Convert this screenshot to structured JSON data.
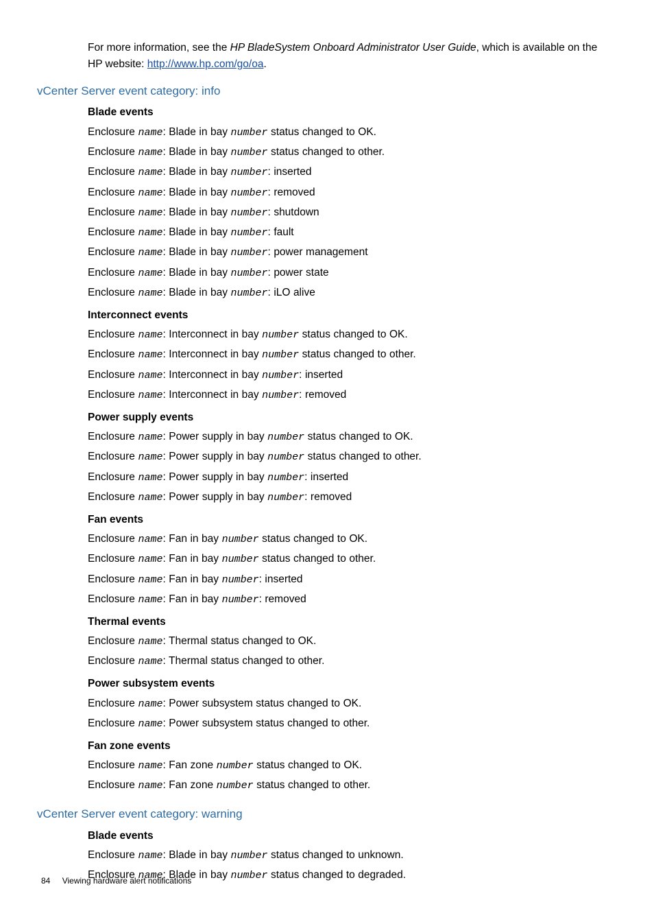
{
  "intro": {
    "pre": "For more information, see the ",
    "ital": "HP BladeSystem Onboard Administrator User Guide",
    "post1": ", which is available on the HP website: ",
    "link": "http://www.hp.com/go/oa",
    "post2": "."
  },
  "sections": [
    {
      "title": "vCenter Server event category: info",
      "groups": [
        {
          "heading": "Blade events",
          "lines": [
            [
              [
                "t",
                "Enclosure "
              ],
              [
                "v",
                "name"
              ],
              [
                "t",
                ": Blade in bay "
              ],
              [
                "v",
                "number"
              ],
              [
                "t",
                " status changed to OK."
              ]
            ],
            [
              [
                "t",
                "Enclosure "
              ],
              [
                "v",
                "name"
              ],
              [
                "t",
                ": Blade in bay "
              ],
              [
                "v",
                "number"
              ],
              [
                "t",
                " status changed to other."
              ]
            ],
            [
              [
                "t",
                "Enclosure "
              ],
              [
                "v",
                "name"
              ],
              [
                "t",
                ": Blade in bay "
              ],
              [
                "v",
                "number"
              ],
              [
                "t",
                ": inserted"
              ]
            ],
            [
              [
                "t",
                "Enclosure "
              ],
              [
                "v",
                "name"
              ],
              [
                "t",
                ": Blade in bay "
              ],
              [
                "v",
                "number"
              ],
              [
                "t",
                ": removed"
              ]
            ],
            [
              [
                "t",
                "Enclosure "
              ],
              [
                "v",
                "name"
              ],
              [
                "t",
                ": Blade in bay "
              ],
              [
                "v",
                "number"
              ],
              [
                "t",
                ": shutdown"
              ]
            ],
            [
              [
                "t",
                "Enclosure "
              ],
              [
                "v",
                "name"
              ],
              [
                "t",
                ": Blade in bay "
              ],
              [
                "v",
                "number"
              ],
              [
                "t",
                ": fault"
              ]
            ],
            [
              [
                "t",
                "Enclosure "
              ],
              [
                "v",
                "name"
              ],
              [
                "t",
                ": Blade in bay "
              ],
              [
                "v",
                "number"
              ],
              [
                "t",
                ": power management"
              ]
            ],
            [
              [
                "t",
                "Enclosure "
              ],
              [
                "v",
                "name"
              ],
              [
                "t",
                ": Blade in bay "
              ],
              [
                "v",
                "number"
              ],
              [
                "t",
                ": power state"
              ]
            ],
            [
              [
                "t",
                "Enclosure "
              ],
              [
                "v",
                "name"
              ],
              [
                "t",
                ": Blade in bay "
              ],
              [
                "v",
                "number"
              ],
              [
                "t",
                ": iLO alive"
              ]
            ]
          ]
        },
        {
          "heading": "Interconnect events",
          "lines": [
            [
              [
                "t",
                "Enclosure "
              ],
              [
                "v",
                "name"
              ],
              [
                "t",
                ": Interconnect in bay "
              ],
              [
                "v",
                "number"
              ],
              [
                "t",
                " status changed to OK."
              ]
            ],
            [
              [
                "t",
                "Enclosure "
              ],
              [
                "v",
                "name"
              ],
              [
                "t",
                ": Interconnect in bay "
              ],
              [
                "v",
                "number"
              ],
              [
                "t",
                " status changed to other."
              ]
            ],
            [
              [
                "t",
                "Enclosure "
              ],
              [
                "v",
                "name"
              ],
              [
                "t",
                ": Interconnect in bay "
              ],
              [
                "v",
                "number"
              ],
              [
                "t",
                ": inserted"
              ]
            ],
            [
              [
                "t",
                "Enclosure "
              ],
              [
                "v",
                "name"
              ],
              [
                "t",
                ": Interconnect in bay "
              ],
              [
                "v",
                "number"
              ],
              [
                "t",
                ": removed"
              ]
            ]
          ]
        },
        {
          "heading": "Power supply events",
          "lines": [
            [
              [
                "t",
                "Enclosure "
              ],
              [
                "v",
                "name"
              ],
              [
                "t",
                ": Power supply in bay "
              ],
              [
                "v",
                "number"
              ],
              [
                "t",
                " status changed to OK."
              ]
            ],
            [
              [
                "t",
                "Enclosure "
              ],
              [
                "v",
                "name"
              ],
              [
                "t",
                ": Power supply in bay "
              ],
              [
                "v",
                "number"
              ],
              [
                "t",
                " status changed to other."
              ]
            ],
            [
              [
                "t",
                "Enclosure "
              ],
              [
                "v",
                "name"
              ],
              [
                "t",
                ": Power supply in bay "
              ],
              [
                "v",
                "number"
              ],
              [
                "t",
                ": inserted"
              ]
            ],
            [
              [
                "t",
                "Enclosure "
              ],
              [
                "v",
                "name"
              ],
              [
                "t",
                ": Power supply in bay "
              ],
              [
                "v",
                "number"
              ],
              [
                "t",
                ": removed"
              ]
            ]
          ]
        },
        {
          "heading": "Fan events",
          "lines": [
            [
              [
                "t",
                "Enclosure "
              ],
              [
                "v",
                "name"
              ],
              [
                "t",
                ": Fan in bay "
              ],
              [
                "v",
                "number"
              ],
              [
                "t",
                " status changed to OK."
              ]
            ],
            [
              [
                "t",
                "Enclosure "
              ],
              [
                "v",
                "name"
              ],
              [
                "t",
                ": Fan in bay "
              ],
              [
                "v",
                "number"
              ],
              [
                "t",
                " status changed to other."
              ]
            ],
            [
              [
                "t",
                "Enclosure "
              ],
              [
                "v",
                "name"
              ],
              [
                "t",
                ": Fan in bay "
              ],
              [
                "v",
                "number"
              ],
              [
                "t",
                ": inserted"
              ]
            ],
            [
              [
                "t",
                "Enclosure "
              ],
              [
                "v",
                "name"
              ],
              [
                "t",
                ": Fan in bay "
              ],
              [
                "v",
                "number"
              ],
              [
                "t",
                ": removed"
              ]
            ]
          ]
        },
        {
          "heading": "Thermal events",
          "lines": [
            [
              [
                "t",
                "Enclosure "
              ],
              [
                "v",
                "name"
              ],
              [
                "t",
                ": Thermal status changed to OK."
              ]
            ],
            [
              [
                "t",
                "Enclosure "
              ],
              [
                "v",
                "name"
              ],
              [
                "t",
                ": Thermal status changed to other."
              ]
            ]
          ]
        },
        {
          "heading": "Power subsystem events",
          "lines": [
            [
              [
                "t",
                "Enclosure "
              ],
              [
                "v",
                "name"
              ],
              [
                "t",
                ": Power subsystem status changed to OK."
              ]
            ],
            [
              [
                "t",
                "Enclosure "
              ],
              [
                "v",
                "name"
              ],
              [
                "t",
                ": Power subsystem status changed to other."
              ]
            ]
          ]
        },
        {
          "heading": "Fan zone events",
          "lines": [
            [
              [
                "t",
                "Enclosure "
              ],
              [
                "v",
                "name"
              ],
              [
                "t",
                ": Fan zone "
              ],
              [
                "v",
                "number"
              ],
              [
                "t",
                " status changed to OK."
              ]
            ],
            [
              [
                "t",
                "Enclosure "
              ],
              [
                "v",
                "name"
              ],
              [
                "t",
                ": Fan zone "
              ],
              [
                "v",
                "number"
              ],
              [
                "t",
                " status changed to other."
              ]
            ]
          ]
        }
      ]
    },
    {
      "title": "vCenter Server event category: warning",
      "groups": [
        {
          "heading": "Blade events",
          "lines": [
            [
              [
                "t",
                "Enclosure "
              ],
              [
                "v",
                "name"
              ],
              [
                "t",
                ": Blade in bay "
              ],
              [
                "v",
                "number"
              ],
              [
                "t",
                " status changed to unknown."
              ]
            ],
            [
              [
                "t",
                "Enclosure "
              ],
              [
                "v",
                "name"
              ],
              [
                "t",
                ": Blade in bay "
              ],
              [
                "v",
                "number"
              ],
              [
                "t",
                " status changed to degraded."
              ]
            ]
          ]
        }
      ]
    }
  ],
  "footer": {
    "page": "84",
    "title": "Viewing hardware alert notifications"
  }
}
